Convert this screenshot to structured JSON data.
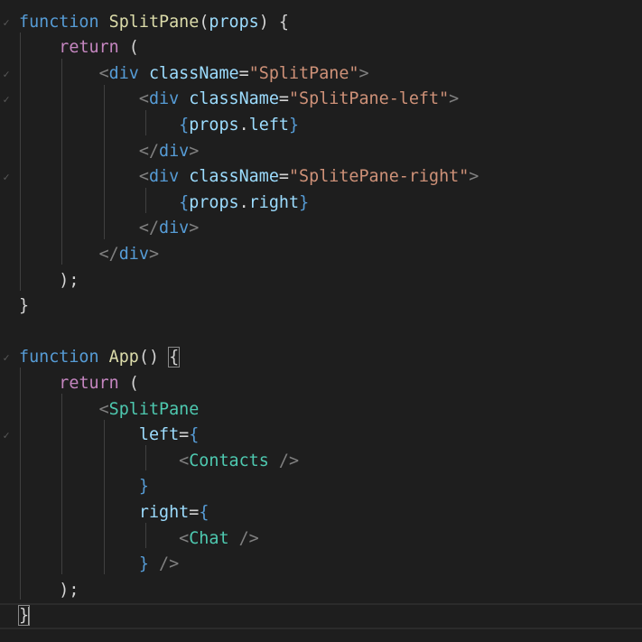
{
  "editor": {
    "lines": [
      {
        "fold": true,
        "tokens": [
          {
            "t": "function",
            "c": "kw"
          },
          {
            "t": " ",
            "c": "plain"
          },
          {
            "t": "SplitPane",
            "c": "fn"
          },
          {
            "t": "(",
            "c": "plain"
          },
          {
            "t": "props",
            "c": "param"
          },
          {
            "t": ") {",
            "c": "plain"
          }
        ]
      },
      {
        "fold": false,
        "tokens": [
          {
            "t": "    ",
            "c": "plain"
          },
          {
            "t": "return",
            "c": "ctl"
          },
          {
            "t": " (",
            "c": "plain"
          }
        ]
      },
      {
        "fold": true,
        "tokens": [
          {
            "t": "        ",
            "c": "plain"
          },
          {
            "t": "<",
            "c": "punct"
          },
          {
            "t": "div",
            "c": "tag"
          },
          {
            "t": " ",
            "c": "plain"
          },
          {
            "t": "className",
            "c": "attr"
          },
          {
            "t": "=",
            "c": "plain"
          },
          {
            "t": "\"SplitPane\"",
            "c": "str"
          },
          {
            "t": ">",
            "c": "punct"
          }
        ]
      },
      {
        "fold": true,
        "tokens": [
          {
            "t": "            ",
            "c": "plain"
          },
          {
            "t": "<",
            "c": "punct"
          },
          {
            "t": "div",
            "c": "tag"
          },
          {
            "t": " ",
            "c": "plain"
          },
          {
            "t": "className",
            "c": "attr"
          },
          {
            "t": "=",
            "c": "plain"
          },
          {
            "t": "\"SplitPane-left\"",
            "c": "str"
          },
          {
            "t": ">",
            "c": "punct"
          }
        ]
      },
      {
        "fold": false,
        "tokens": [
          {
            "t": "                ",
            "c": "plain"
          },
          {
            "t": "{",
            "c": "brace"
          },
          {
            "t": "props",
            "c": "jsx"
          },
          {
            "t": ".",
            "c": "plain"
          },
          {
            "t": "left",
            "c": "jsx"
          },
          {
            "t": "}",
            "c": "brace"
          }
        ]
      },
      {
        "fold": false,
        "tokens": [
          {
            "t": "            ",
            "c": "plain"
          },
          {
            "t": "</",
            "c": "punct"
          },
          {
            "t": "div",
            "c": "tag"
          },
          {
            "t": ">",
            "c": "punct"
          }
        ]
      },
      {
        "fold": true,
        "tokens": [
          {
            "t": "            ",
            "c": "plain"
          },
          {
            "t": "<",
            "c": "punct"
          },
          {
            "t": "div",
            "c": "tag"
          },
          {
            "t": " ",
            "c": "plain"
          },
          {
            "t": "className",
            "c": "attr"
          },
          {
            "t": "=",
            "c": "plain"
          },
          {
            "t": "\"SplitePane-right\"",
            "c": "str"
          },
          {
            "t": ">",
            "c": "punct"
          }
        ]
      },
      {
        "fold": false,
        "tokens": [
          {
            "t": "                ",
            "c": "plain"
          },
          {
            "t": "{",
            "c": "brace"
          },
          {
            "t": "props",
            "c": "jsx"
          },
          {
            "t": ".",
            "c": "plain"
          },
          {
            "t": "right",
            "c": "jsx"
          },
          {
            "t": "}",
            "c": "brace"
          }
        ]
      },
      {
        "fold": false,
        "tokens": [
          {
            "t": "            ",
            "c": "plain"
          },
          {
            "t": "</",
            "c": "punct"
          },
          {
            "t": "div",
            "c": "tag"
          },
          {
            "t": ">",
            "c": "punct"
          }
        ]
      },
      {
        "fold": false,
        "tokens": [
          {
            "t": "        ",
            "c": "plain"
          },
          {
            "t": "</",
            "c": "punct"
          },
          {
            "t": "div",
            "c": "tag"
          },
          {
            "t": ">",
            "c": "punct"
          }
        ]
      },
      {
        "fold": false,
        "tokens": [
          {
            "t": "    ",
            "c": "plain"
          },
          {
            "t": ");",
            "c": "plain"
          }
        ]
      },
      {
        "fold": false,
        "tokens": [
          {
            "t": "}",
            "c": "plain"
          }
        ]
      },
      {
        "fold": false,
        "tokens": []
      },
      {
        "fold": true,
        "tokens": [
          {
            "t": "function",
            "c": "kw"
          },
          {
            "t": " ",
            "c": "plain"
          },
          {
            "t": "App",
            "c": "fn"
          },
          {
            "t": "() ",
            "c": "plain"
          },
          {
            "t": "{",
            "c": "plain match"
          }
        ]
      },
      {
        "fold": false,
        "tokens": [
          {
            "t": "    ",
            "c": "plain"
          },
          {
            "t": "return",
            "c": "ctl"
          },
          {
            "t": " (",
            "c": "plain"
          }
        ]
      },
      {
        "fold": false,
        "tokens": [
          {
            "t": "        ",
            "c": "plain"
          },
          {
            "t": "<",
            "c": "punct"
          },
          {
            "t": "SplitPane",
            "c": "comp"
          }
        ]
      },
      {
        "fold": true,
        "tokens": [
          {
            "t": "            ",
            "c": "plain"
          },
          {
            "t": "left",
            "c": "attr"
          },
          {
            "t": "=",
            "c": "plain"
          },
          {
            "t": "{",
            "c": "brace"
          }
        ]
      },
      {
        "fold": false,
        "tokens": [
          {
            "t": "                ",
            "c": "plain"
          },
          {
            "t": "<",
            "c": "punct"
          },
          {
            "t": "Contacts",
            "c": "comp"
          },
          {
            "t": " />",
            "c": "punct"
          }
        ]
      },
      {
        "fold": false,
        "tokens": [
          {
            "t": "            ",
            "c": "plain"
          },
          {
            "t": "}",
            "c": "brace"
          }
        ]
      },
      {
        "fold": false,
        "tokens": [
          {
            "t": "            ",
            "c": "plain"
          },
          {
            "t": "right",
            "c": "attr"
          },
          {
            "t": "=",
            "c": "plain"
          },
          {
            "t": "{",
            "c": "brace"
          }
        ]
      },
      {
        "fold": false,
        "tokens": [
          {
            "t": "                ",
            "c": "plain"
          },
          {
            "t": "<",
            "c": "punct"
          },
          {
            "t": "Chat",
            "c": "comp"
          },
          {
            "t": " />",
            "c": "punct"
          }
        ]
      },
      {
        "fold": false,
        "tokens": [
          {
            "t": "            ",
            "c": "plain"
          },
          {
            "t": "}",
            "c": "brace"
          },
          {
            "t": " />",
            "c": "punct"
          }
        ]
      },
      {
        "fold": false,
        "tokens": [
          {
            "t": "    ",
            "c": "plain"
          },
          {
            "t": ");",
            "c": "plain"
          }
        ]
      },
      {
        "fold": false,
        "current": true,
        "tokens": [
          {
            "t": "}",
            "c": "plain match"
          }
        ]
      }
    ]
  }
}
